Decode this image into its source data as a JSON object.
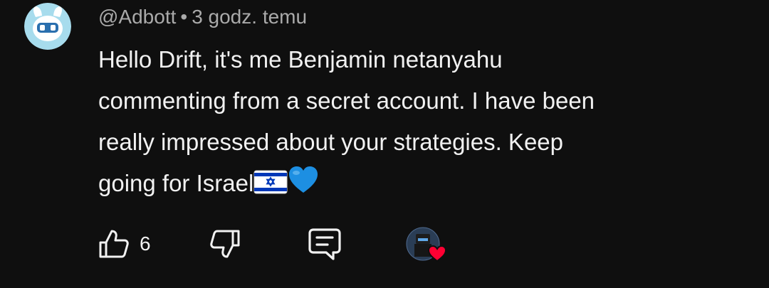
{
  "comment": {
    "author": "@Adbott",
    "separator": "•",
    "timestamp": "3 godz. temu",
    "lines": [
      "Hello Drift, it's me Benjamin netanyahu",
      "commenting from a secret account. I have been",
      "really impressed about your strategies. Keep",
      "going for Israel"
    ],
    "emojis": [
      "israel-flag",
      "blue-heart"
    ]
  },
  "actions": {
    "like_count": "6"
  },
  "colors": {
    "background": "#0f0f0f",
    "text": "#f1f1f1",
    "meta": "#aaaaaa",
    "avatar_bg": "#a7dced",
    "heart": "#ff0033",
    "blue_heart": "#1d8fe2",
    "flag_blue": "#0038b8"
  },
  "icons": {
    "like": "thumbs-up-icon",
    "dislike": "thumbs-down-icon",
    "reply": "comment-icon",
    "creator_heart": "creator-heart-icon"
  }
}
